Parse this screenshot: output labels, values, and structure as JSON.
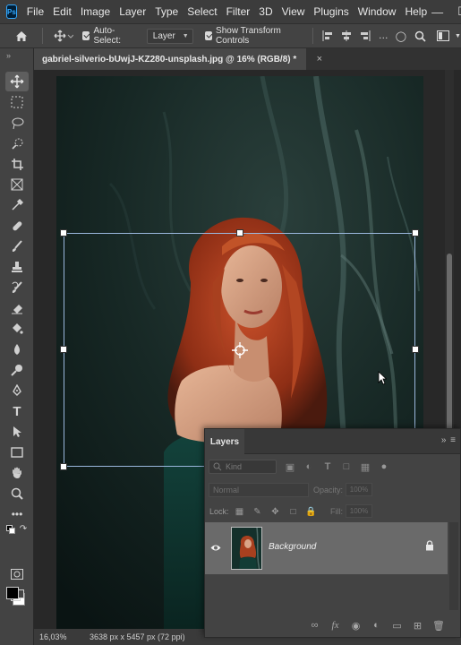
{
  "app": {
    "logo": "Ps"
  },
  "menu": [
    "File",
    "Edit",
    "Image",
    "Layer",
    "Type",
    "Select",
    "Filter",
    "3D",
    "View",
    "Plugins",
    "Window",
    "Help"
  ],
  "window_controls": {
    "minimize": "—",
    "maximize": "☐",
    "close": "✕"
  },
  "options": {
    "auto_select_label": "Auto-Select:",
    "auto_select_checked": true,
    "auto_select_target": "Layer",
    "show_transform_label": "Show Transform Controls",
    "show_transform_checked": true
  },
  "document": {
    "tab_title": "gabriel-silverio-bUwjJ-KZ280-unsplash.jpg @ 16% (RGB/8) *",
    "close_glyph": "×"
  },
  "toolbar": {
    "collapse_glyph": "»",
    "tools": [
      "move-tool",
      "marquee-tool",
      "lasso-tool",
      "object-select-tool",
      "crop-tool",
      "frame-tool",
      "eyedropper-tool",
      "healing-brush-tool",
      "brush-tool",
      "clone-stamp-tool",
      "history-brush-tool",
      "eraser-tool",
      "paint-bucket-tool",
      "blur-tool",
      "dodge-tool",
      "pen-tool",
      "type-tool",
      "path-select-tool",
      "rectangle-tool",
      "hand-tool",
      "zoom-tool",
      "more-tools",
      "default-colors",
      "quick-mask-mode",
      "screen-mode"
    ],
    "foreground_color": "#000000",
    "background_color": "#ffffff"
  },
  "status": {
    "zoom": "16,03%",
    "doc_info": "3638 px x 5457 px (72 ppi)"
  },
  "layers_panel": {
    "title": "Layers",
    "menu_glyph": "» ≡",
    "kind_placeholder": "Kind",
    "blend_mode": "Normal",
    "opacity_label": "Opacity:",
    "opacity_value": "100%",
    "lock_label": "Lock:",
    "fill_label": "Fill:",
    "fill_value": "100%",
    "layers": [
      {
        "name": "Background",
        "visible": true,
        "locked": true
      }
    ]
  },
  "colors": {
    "accent_transform": "#9ab7dd",
    "panel_bg": "#434343",
    "selected_layer": "#6a6a6a"
  }
}
